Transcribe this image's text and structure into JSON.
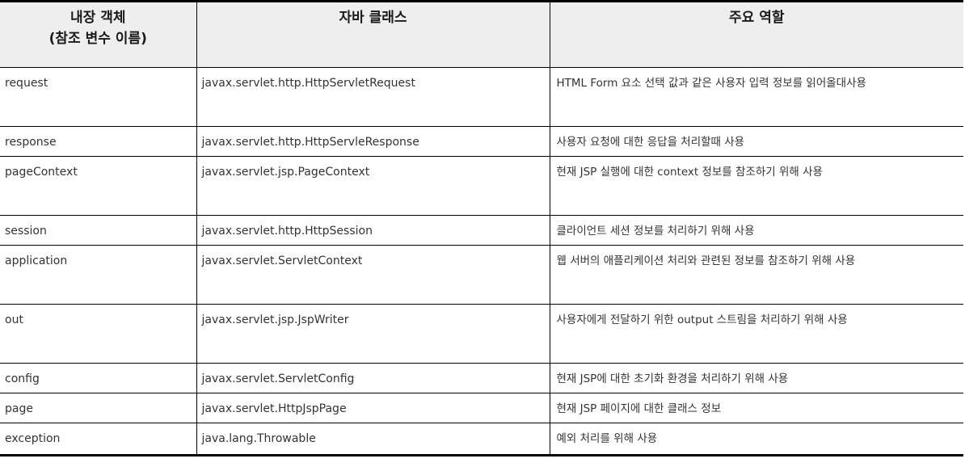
{
  "table": {
    "headers": {
      "col1_line1": "내장 객체",
      "col1_line2": "(참조 변수 이름)",
      "col2": "자바 클래스",
      "col3": "주요 역할"
    },
    "rows": [
      {
        "object": "request",
        "class": "javax.servlet.http.HttpServletRequest",
        "role": "HTML Form 요소 선택 값과 같은 사용자 입력 정보를 읽어올대사용"
      },
      {
        "object": "response",
        "class": "javax.servlet.http.HttpServleResponse",
        "role": "사용자 요청에 대한 응답을 처리할때 사용"
      },
      {
        "object": "pageContext",
        "class": "javax.servlet.jsp.PageContext",
        "role": "현재 JSP 실행에 대한 context 정보를 참조하기 위해 사용"
      },
      {
        "object": "session",
        "class": "javax.servlet.http.HttpSession",
        "role": "클라이언트 세션 정보를 처리하기 위해 사용"
      },
      {
        "object": "application",
        "class": "javax.servlet.ServletContext",
        "role": "웹 서버의 애플리케이션 처리와 관련된 정보를 참조하기 위해 사용"
      },
      {
        "object": "out",
        "class": "javax.servlet.jsp.JspWriter",
        "role": "사용자에게 전달하기 위한 output 스트림을 처리하기 위해 사용"
      },
      {
        "object": "config",
        "class": "javax.servlet.ServletConfig",
        "role": "현재 JSP에 대한 초기화 환경을 처리하기 위해 사용"
      },
      {
        "object": "page",
        "class": "javax.servlet.HttpJspPage",
        "role": "현재 JSP 페이지에 대한 클래스 정보"
      },
      {
        "object": "exception",
        "class": "java.lang.Throwable",
        "role": "예외 처리를 위해 사용"
      }
    ]
  }
}
